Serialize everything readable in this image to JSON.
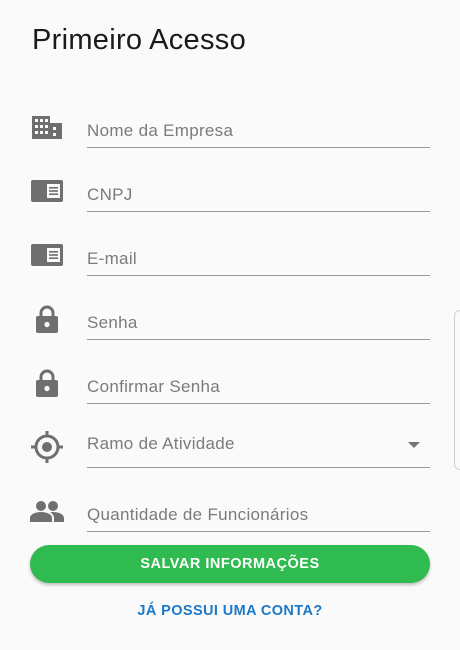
{
  "page": {
    "title": "Primeiro Acesso"
  },
  "form": {
    "fields": [
      {
        "placeholder": "Nome da Empresa",
        "icon": "building-icon"
      },
      {
        "placeholder": "CNPJ",
        "icon": "id-card-icon"
      },
      {
        "placeholder": "E-mail",
        "icon": "id-card-icon"
      },
      {
        "placeholder": "Senha",
        "icon": "lock-icon"
      },
      {
        "placeholder": "Confirmar Senha",
        "icon": "lock-icon"
      },
      {
        "placeholder": "Ramo de Atividade",
        "icon": "target-icon",
        "type": "select"
      },
      {
        "placeholder": "Quantidade de Funcionários",
        "icon": "people-icon"
      }
    ]
  },
  "actions": {
    "save_label": "SALVAR INFORMAÇÕES",
    "login_link_label": "JÁ POSSUI UMA CONTA?"
  },
  "colors": {
    "primary_button": "#2fbb4f",
    "link": "#1c78c7",
    "icon": "#6f6f6f"
  }
}
